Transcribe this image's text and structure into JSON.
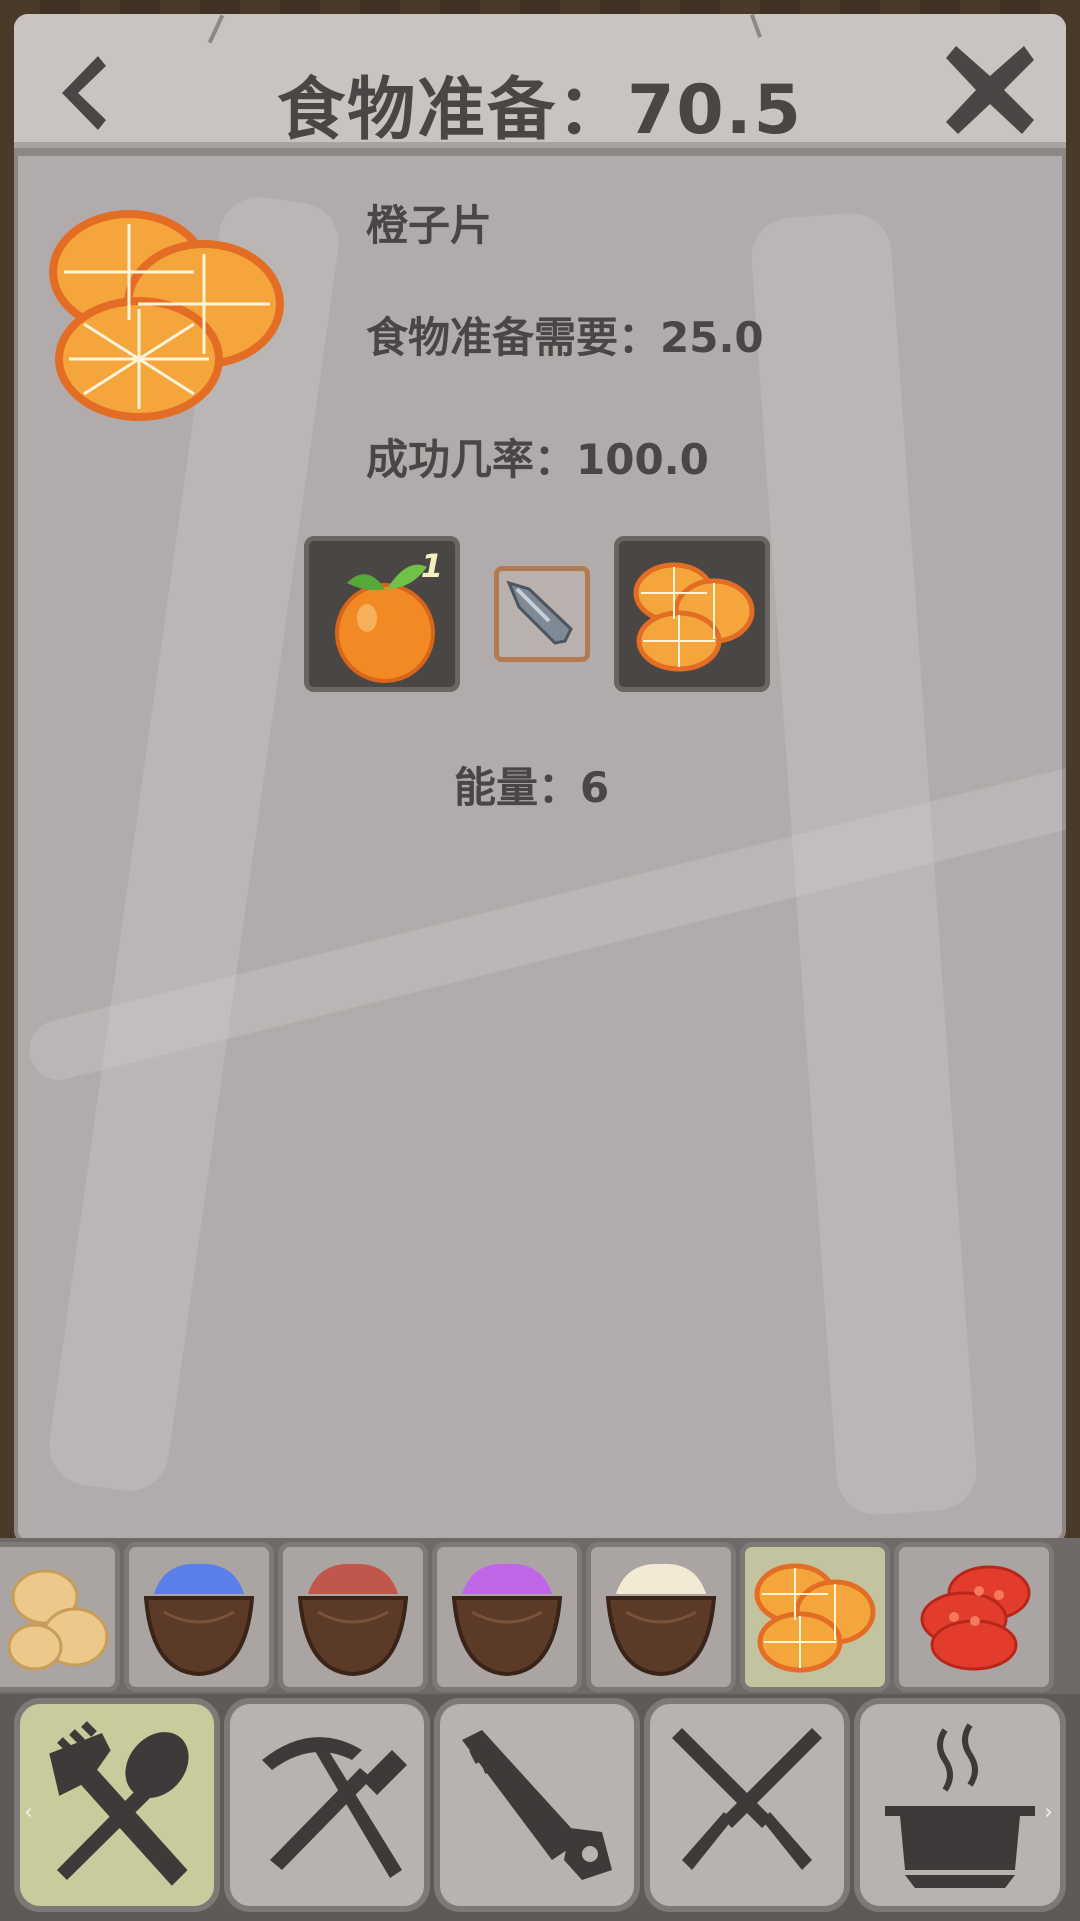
{
  "header": {
    "title": "食物准备：70.5"
  },
  "item": {
    "name": "橙子片",
    "prep_required": "食物准备需要：25.0",
    "success_rate": "成功几率：100.0",
    "energy": "能量：6"
  },
  "recipe_inputs": {
    "ingredient_count": "1",
    "ingredient_icon": "orange-icon",
    "tool_icon": "stone-knife-icon",
    "result_icon": "orange-slices-icon"
  },
  "recipe_strip": [
    {
      "icon": "nuts-icon"
    },
    {
      "icon": "blue-cream-bowl-icon",
      "color": "#5b7fe8"
    },
    {
      "icon": "red-cream-bowl-icon",
      "color": "#c0574a"
    },
    {
      "icon": "purple-cream-bowl-icon",
      "color": "#c067e8"
    },
    {
      "icon": "white-cream-bowl-icon",
      "color": "#f3ead6"
    },
    {
      "icon": "orange-slices-icon",
      "selected": true
    },
    {
      "icon": "tomato-slices-icon"
    }
  ],
  "categories": [
    {
      "icon": "fork-spoon-icon",
      "selected": true
    },
    {
      "icon": "pickaxe-hammer-icon"
    },
    {
      "icon": "saw-icon"
    },
    {
      "icon": "crossed-knives-icon"
    },
    {
      "icon": "cooking-pot-icon"
    }
  ],
  "colors": {
    "panel": "#b1acab",
    "text": "#4b4646",
    "selected": "#c8cb9c",
    "orange": "#f39a2c"
  }
}
